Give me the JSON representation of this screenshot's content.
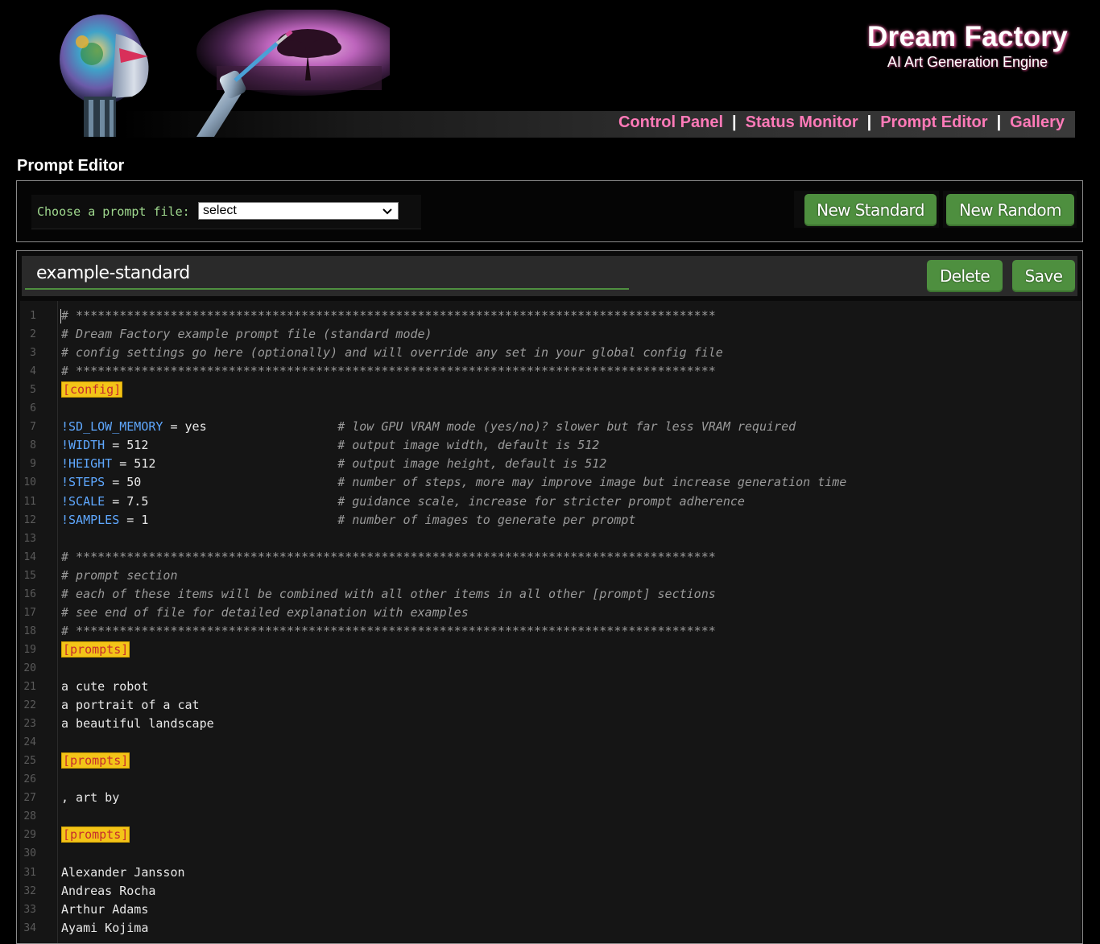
{
  "brand": {
    "title": "Dream Factory",
    "subtitle": "AI Art Generation Engine"
  },
  "nav": {
    "links": [
      "Control Panel",
      "Status Monitor",
      "Prompt Editor",
      "Gallery"
    ],
    "separator": "|"
  },
  "page": {
    "title": "Prompt Editor"
  },
  "chooser": {
    "label": "Choose a prompt file:",
    "selected": "select"
  },
  "buttons": {
    "new_standard": "New Standard",
    "new_random": "New Random",
    "delete": "Delete",
    "save": "Save"
  },
  "editor": {
    "filename": "example-standard",
    "lines": [
      {
        "n": "1",
        "t": "c",
        "text": "# ****************************************************************************************"
      },
      {
        "n": "2",
        "t": "c",
        "text": "# Dream Factory example prompt file (standard mode)"
      },
      {
        "n": "3",
        "t": "c",
        "text": "# config settings go here (optionally) and will override any set in your global config file"
      },
      {
        "n": "4",
        "t": "c",
        "text": "# ****************************************************************************************"
      },
      {
        "n": "5",
        "t": "s",
        "text": "[config]"
      },
      {
        "n": "6",
        "t": "p",
        "text": ""
      },
      {
        "n": "7",
        "t": "k",
        "key": "!SD_LOW_MEMORY",
        "val": "yes",
        "comment": "# low GPU VRAM mode (yes/no)? slower but far less VRAM required"
      },
      {
        "n": "8",
        "t": "k",
        "key": "!WIDTH",
        "val": "512",
        "comment": "# output image width, default is 512"
      },
      {
        "n": "9",
        "t": "k",
        "key": "!HEIGHT",
        "val": "512",
        "comment": "# output image height, default is 512"
      },
      {
        "n": "10",
        "t": "k",
        "key": "!STEPS",
        "val": "50",
        "comment": "# number of steps, more may improve image but increase generation time"
      },
      {
        "n": "11",
        "t": "k",
        "key": "!SCALE",
        "val": "7.5",
        "comment": "# guidance scale, increase for stricter prompt adherence"
      },
      {
        "n": "12",
        "t": "k",
        "key": "!SAMPLES",
        "val": "1",
        "comment": "# number of images to generate per prompt"
      },
      {
        "n": "13",
        "t": "p",
        "text": ""
      },
      {
        "n": "14",
        "t": "c",
        "text": "# ****************************************************************************************"
      },
      {
        "n": "15",
        "t": "c",
        "text": "# prompt section"
      },
      {
        "n": "16",
        "t": "c",
        "text": "# each of these items will be combined with all other items in all other [prompt] sections"
      },
      {
        "n": "17",
        "t": "c",
        "text": "# see end of file for detailed explanation with examples"
      },
      {
        "n": "18",
        "t": "c",
        "text": "# ****************************************************************************************"
      },
      {
        "n": "19",
        "t": "s",
        "text": "[prompts]"
      },
      {
        "n": "20",
        "t": "p",
        "text": ""
      },
      {
        "n": "21",
        "t": "p",
        "text": "a cute robot"
      },
      {
        "n": "22",
        "t": "p",
        "text": "a portrait of a cat"
      },
      {
        "n": "23",
        "t": "p",
        "text": "a beautiful landscape"
      },
      {
        "n": "24",
        "t": "p",
        "text": ""
      },
      {
        "n": "25",
        "t": "s",
        "text": "[prompts]"
      },
      {
        "n": "26",
        "t": "p",
        "text": ""
      },
      {
        "n": "27",
        "t": "p",
        "text": ", art by"
      },
      {
        "n": "28",
        "t": "p",
        "text": ""
      },
      {
        "n": "29",
        "t": "s",
        "text": "[prompts]"
      },
      {
        "n": "30",
        "t": "p",
        "text": ""
      },
      {
        "n": "31",
        "t": "p",
        "text": "Alexander Jansson"
      },
      {
        "n": "32",
        "t": "p",
        "text": "Andreas Rocha"
      },
      {
        "n": "33",
        "t": "p",
        "text": "Arthur Adams"
      },
      {
        "n": "34",
        "t": "p",
        "text": "Ayami Kojima"
      }
    ]
  },
  "colors": {
    "nav_link": "#ff7ab8",
    "button_green": "#4e8f3f",
    "section_bg": "#f3c418",
    "section_text": "#c62d2d",
    "setting_key": "#5fa8ff",
    "comment": "#9a9a9a"
  }
}
